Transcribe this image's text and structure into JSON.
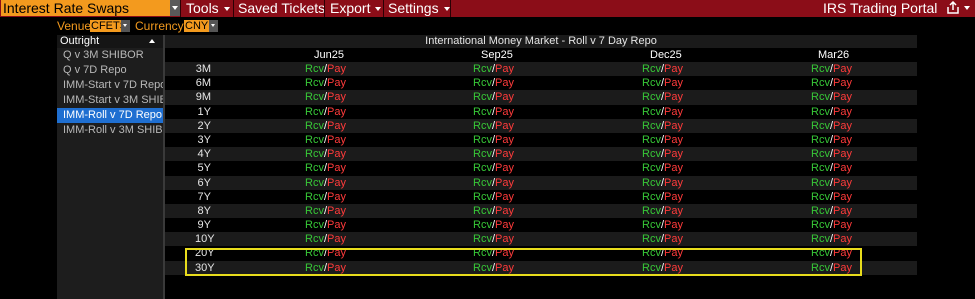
{
  "topbar": {
    "product": "Interest Rate Swaps",
    "menus": [
      {
        "label": "Tools"
      },
      {
        "label": "Saved Tickets"
      },
      {
        "label": "Export"
      },
      {
        "label": "Settings"
      }
    ],
    "portal_title": "IRS Trading Portal"
  },
  "filters": {
    "venue_label": "Venue",
    "venue_value": "CFETS",
    "currency_label": "Currency",
    "currency_value": "CNY"
  },
  "sidebar": {
    "header": "Outright",
    "items": [
      {
        "label": "Q v 3M SHIBOR",
        "selected": false
      },
      {
        "label": "Q v 7D Repo",
        "selected": false
      },
      {
        "label": "IMM-Start v 7D Repo",
        "selected": false
      },
      {
        "label": "IMM-Start v 3M SHIB...",
        "selected": false
      },
      {
        "label": "IMM-Roll v 7D Repo",
        "selected": true
      },
      {
        "label": "IMM-Roll v 3M SHIB...",
        "selected": false
      }
    ]
  },
  "grid": {
    "title": "International Money Market - Roll v 7 Day Repo",
    "columns": [
      "Jun25",
      "Sep25",
      "Dec25",
      "Mar26"
    ],
    "receive_label": "Rcv",
    "separator": "/",
    "pay_label": "Pay",
    "tenors": [
      "3M",
      "6M",
      "9M",
      "1Y",
      "2Y",
      "3Y",
      "4Y",
      "5Y",
      "6Y",
      "7Y",
      "8Y",
      "9Y",
      "10Y",
      "20Y",
      "30Y"
    ],
    "highlighted_tenors": [
      "20Y",
      "30Y"
    ]
  },
  "colors": {
    "topbar": "#8b0d18",
    "accent": "#f39a1e",
    "selected": "#1f6fd1",
    "receive": "#37c837",
    "pay": "#ff3b3b",
    "highlight": "#e8dc1c"
  }
}
